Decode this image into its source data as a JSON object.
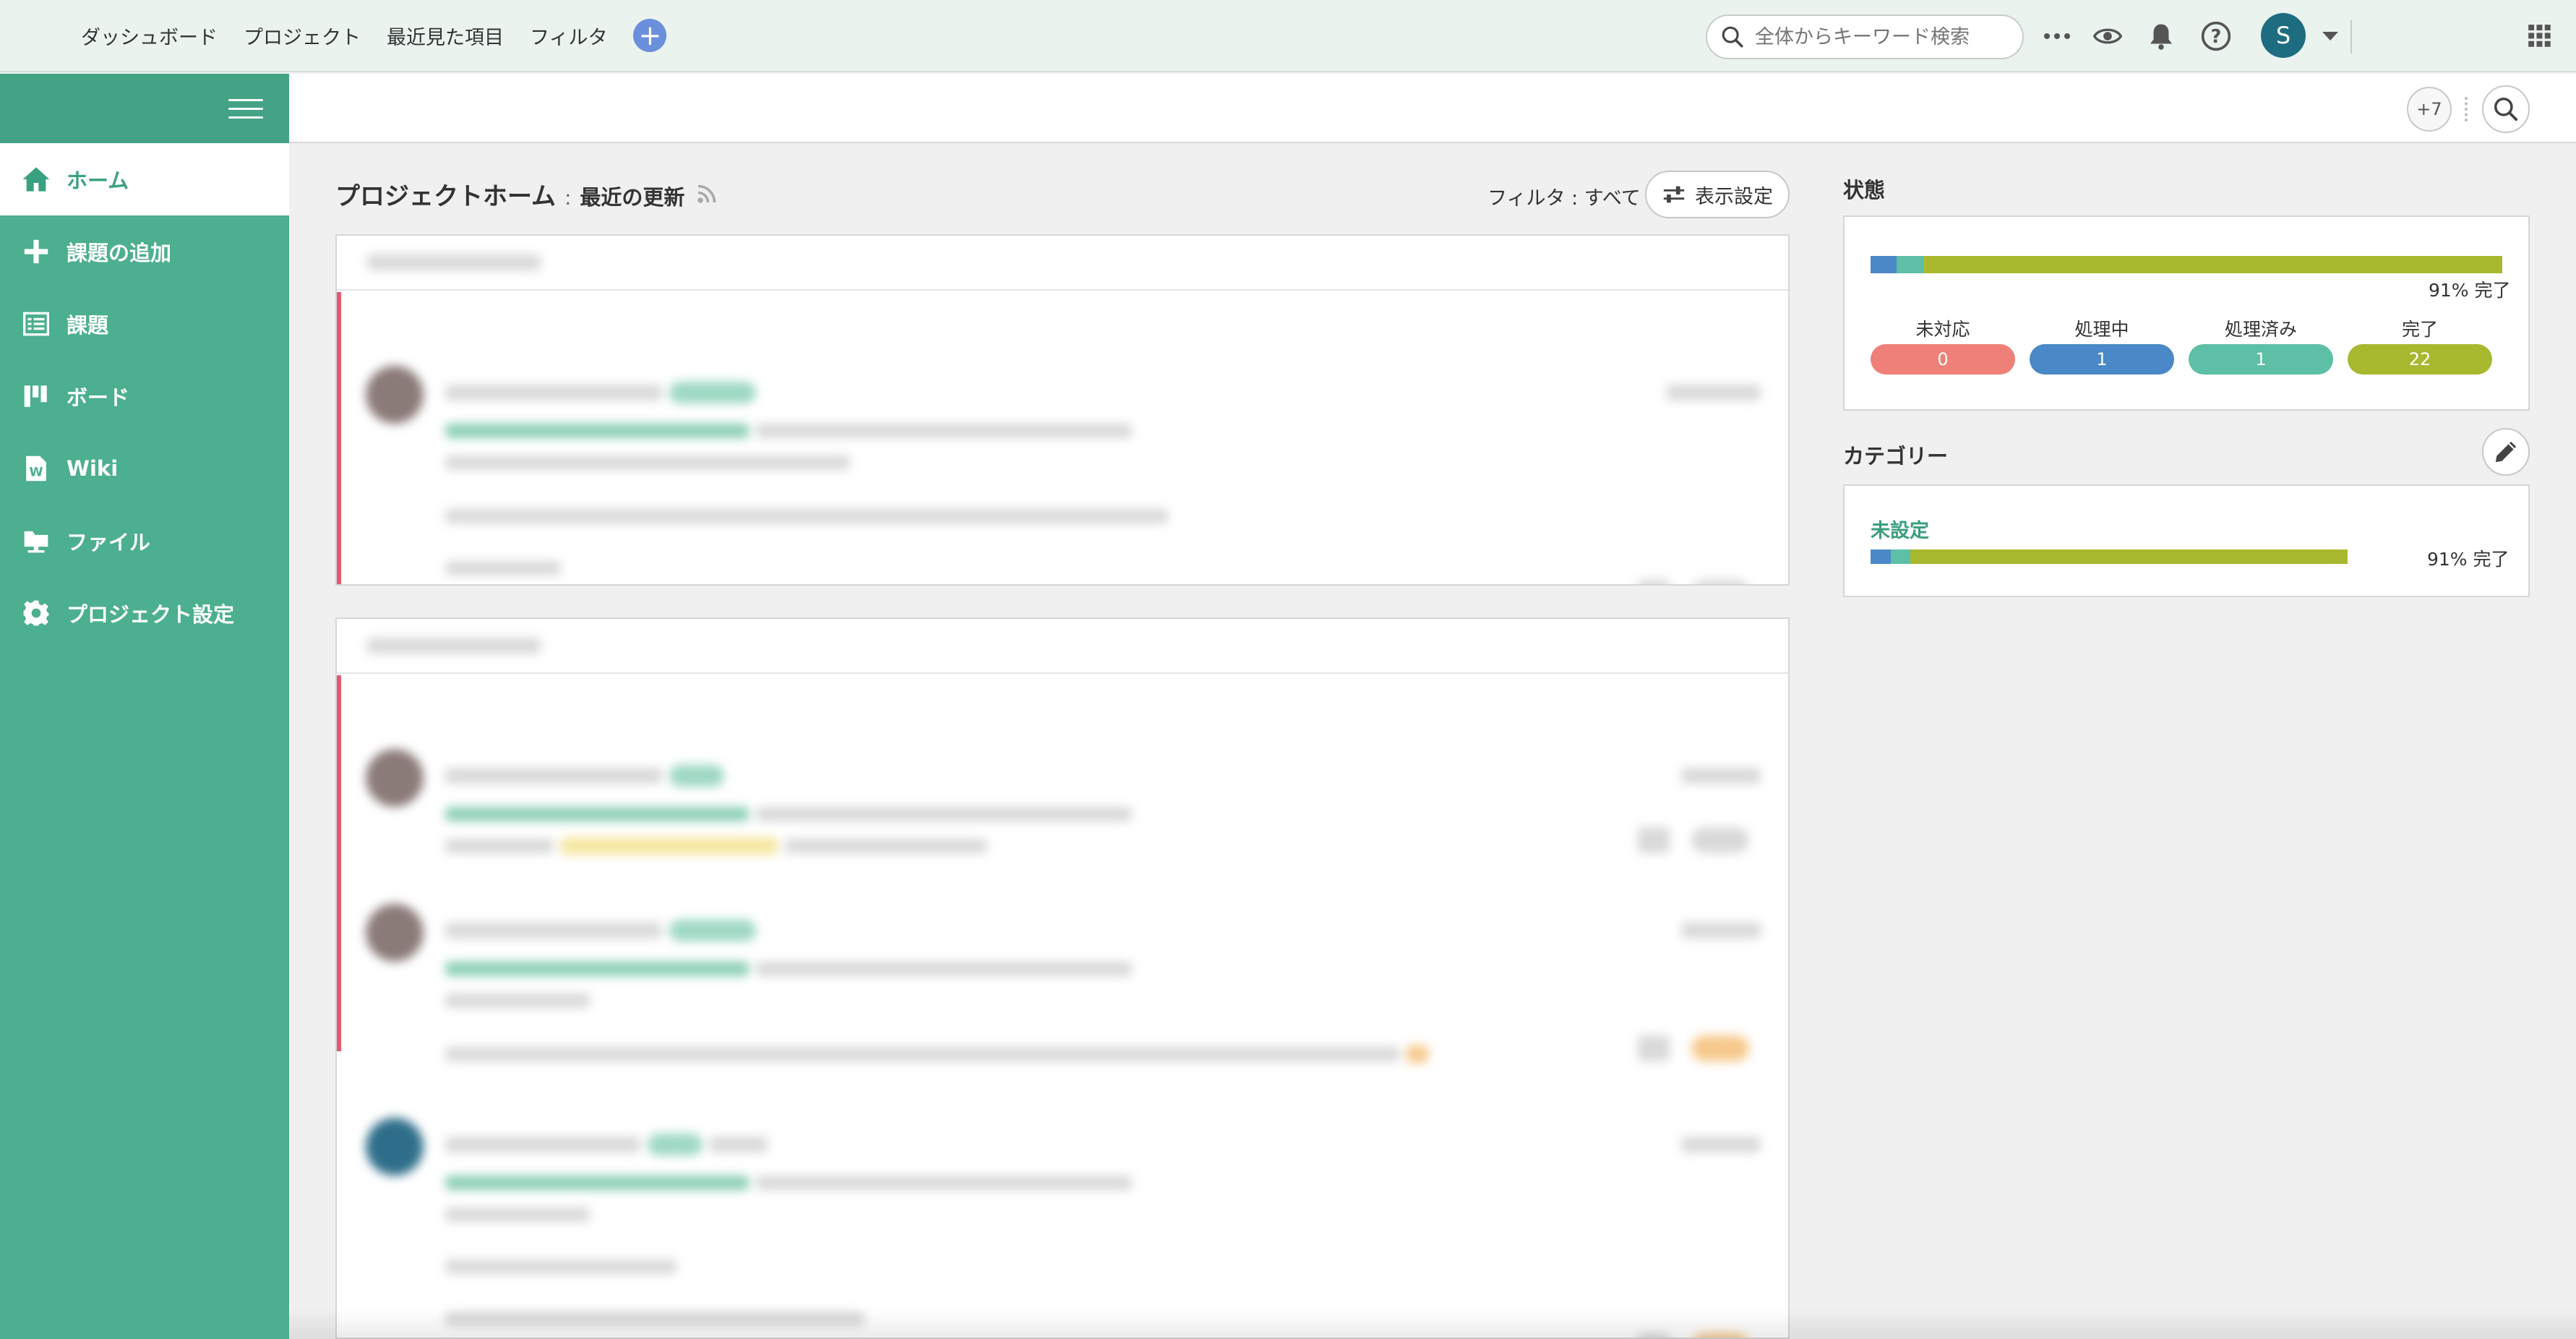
{
  "topbar": {
    "nav": [
      "ダッシュボード",
      "プロジェクト",
      "最近見た項目",
      "フィルタ"
    ],
    "search_placeholder": "全体からキーワード検索",
    "user_initial": "S"
  },
  "subbar": {
    "watchers_badge": "+7"
  },
  "sidebar": {
    "items": [
      {
        "label": "ホーム",
        "icon": "home-icon"
      },
      {
        "label": "課題の追加",
        "icon": "plus-icon"
      },
      {
        "label": "課題",
        "icon": "list-icon"
      },
      {
        "label": "ボード",
        "icon": "board-icon"
      },
      {
        "label": "Wiki",
        "icon": "wiki-icon"
      },
      {
        "label": "ファイル",
        "icon": "folder-icon"
      },
      {
        "label": "プロジェクト設定",
        "icon": "gear-icon"
      }
    ]
  },
  "main": {
    "title": "プロジェクトホーム",
    "separator": ":",
    "subtitle": "最近の更新",
    "filter_label": "フィルタ : すべて",
    "display_settings": "表示設定"
  },
  "status_panel": {
    "title": "状態",
    "percent_label": "91% 完了",
    "progress": {
      "open": 0,
      "in_progress": 1,
      "resolved": 1,
      "closed": 22
    },
    "statuses": [
      {
        "label": "未対応",
        "count": "0",
        "color": "#ef8078"
      },
      {
        "label": "処理中",
        "count": "1",
        "color": "#4a88c7"
      },
      {
        "label": "処理済み",
        "count": "1",
        "color": "#5cbfa6"
      },
      {
        "label": "完了",
        "count": "22",
        "color": "#a8b82f"
      }
    ]
  },
  "category_panel": {
    "title": "カテゴリー",
    "category_name": "未設定",
    "percent_label": "91% 完了"
  },
  "colors": {
    "sidebar": "#4caf8f",
    "accent": "#3aa180",
    "blue": "#4a88c7",
    "teal": "#5cbfa6",
    "olive": "#a8b82f"
  }
}
